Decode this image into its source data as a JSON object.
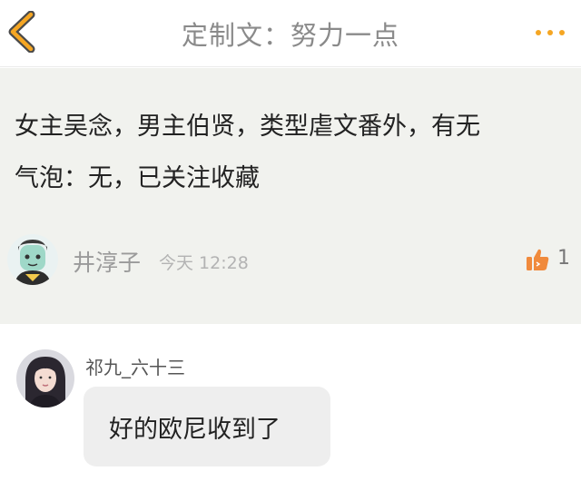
{
  "header": {
    "back_icon": "chevron-left-icon",
    "title": "定制文：努力一点",
    "more_icon": "more-dots-icon",
    "accent_color": "#f5a623"
  },
  "post": {
    "body_line1": "女主吴念，男主伯贤，类型虐文番外，有无",
    "body_line2": "气泡：无，已关注收藏",
    "author": {
      "name": "井淳子",
      "avatar_icon": "cartoon-avatar"
    },
    "time": "今天 12:28",
    "likes": "1",
    "like_icon": "thumbs-up-icon",
    "like_color": "#f08a3c"
  },
  "reply": {
    "author": {
      "name": "祁九_六十三",
      "avatar_icon": "user-photo-avatar"
    },
    "message": "好的欧尼收到了"
  }
}
